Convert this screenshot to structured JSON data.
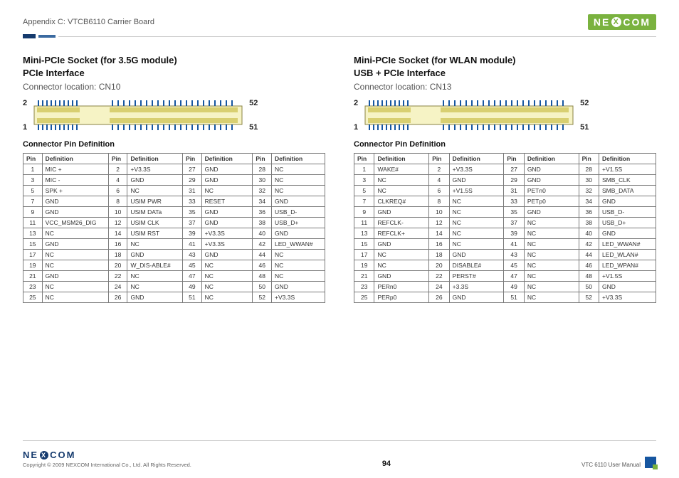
{
  "header": {
    "breadcrumb": "Appendix C: VTCB6110 Carrier Board",
    "brand_left": "NE",
    "brand_right": "COM",
    "brand_x": "X"
  },
  "left": {
    "title_line1": "Mini-PCIe Socket (for 3.5G module)",
    "title_line2": "PCIe Interface",
    "connector_location": "Connector location: CN10",
    "chip_labels": {
      "tl": "2",
      "bl": "1",
      "tr": "52",
      "br": "51"
    },
    "pin_def_label": "Connector Pin Definition",
    "table_headers": [
      "Pin",
      "Definition",
      "Pin",
      "Definition",
      "Pin",
      "Definition",
      "Pin",
      "Definition"
    ],
    "rows": [
      [
        "1",
        "MIC +",
        "2",
        "+V3.3S",
        "27",
        "GND",
        "28",
        "NC"
      ],
      [
        "3",
        "MIC -",
        "4",
        "GND",
        "29",
        "GND",
        "30",
        "NC"
      ],
      [
        "5",
        "SPK +",
        "6",
        "NC",
        "31",
        "NC",
        "32",
        "NC"
      ],
      [
        "7",
        "GND",
        "8",
        "USIM PWR",
        "33",
        "RESET",
        "34",
        "GND"
      ],
      [
        "9",
        "GND",
        "10",
        "USIM DATa",
        "35",
        "GND",
        "36",
        "USB_D-"
      ],
      [
        "11",
        "VCC_MSM26_DIG",
        "12",
        "USIM CLK",
        "37",
        "GND",
        "38",
        "USB_D+"
      ],
      [
        "13",
        "NC",
        "14",
        "USIM RST",
        "39",
        "+V3.3S",
        "40",
        "GND"
      ],
      [
        "15",
        "GND",
        "16",
        "NC",
        "41",
        "+V3.3S",
        "42",
        "LED_WWAN#"
      ],
      [
        "17",
        "NC",
        "18",
        "GND",
        "43",
        "GND",
        "44",
        "NC"
      ],
      [
        "19",
        "NC",
        "20",
        "W_DIS-ABLE#",
        "45",
        "NC",
        "46",
        "NC"
      ],
      [
        "21",
        "GND",
        "22",
        "NC",
        "47",
        "NC",
        "48",
        "NC"
      ],
      [
        "23",
        "NC",
        "24",
        "NC",
        "49",
        "NC",
        "50",
        "GND"
      ],
      [
        "25",
        "NC",
        "26",
        "GND",
        "51",
        "NC",
        "52",
        "+V3.3S"
      ]
    ]
  },
  "right": {
    "title_line1": "Mini-PCIe Socket (for WLAN module)",
    "title_line2": "USB + PCIe Interface",
    "connector_location": "Connector location: CN13",
    "chip_labels": {
      "tl": "2",
      "bl": "1",
      "tr": "52",
      "br": "51"
    },
    "pin_def_label": "Connector Pin Definition",
    "table_headers": [
      "Pin",
      "Definition",
      "Pin",
      "Definition",
      "Pin",
      "Definition",
      "Pin",
      "Definition"
    ],
    "rows": [
      [
        "1",
        "WAKE#",
        "2",
        "+V3.3S",
        "27",
        "GND",
        "28",
        "+V1.5S"
      ],
      [
        "3",
        "NC",
        "4",
        "GND",
        "29",
        "GND",
        "30",
        "SMB_CLK"
      ],
      [
        "5",
        "NC",
        "6",
        "+V1.5S",
        "31",
        "PETn0",
        "32",
        "SMB_DATA"
      ],
      [
        "7",
        "CLKREQ#",
        "8",
        "NC",
        "33",
        "PETp0",
        "34",
        "GND"
      ],
      [
        "9",
        "GND",
        "10",
        "NC",
        "35",
        "GND",
        "36",
        "USB_D-"
      ],
      [
        "11",
        "REFCLK-",
        "12",
        "NC",
        "37",
        "NC",
        "38",
        "USB_D+"
      ],
      [
        "13",
        "REFCLK+",
        "14",
        "NC",
        "39",
        "NC",
        "40",
        "GND"
      ],
      [
        "15",
        "GND",
        "16",
        "NC",
        "41",
        "NC",
        "42",
        "LED_WWAN#"
      ],
      [
        "17",
        "NC",
        "18",
        "GND",
        "43",
        "NC",
        "44",
        "LED_WLAN#"
      ],
      [
        "19",
        "NC",
        "20",
        "DISABLE#",
        "45",
        "NC",
        "46",
        "LED_WPAN#"
      ],
      [
        "21",
        "GND",
        "22",
        "PERST#",
        "47",
        "NC",
        "48",
        "+V1.5S"
      ],
      [
        "23",
        "PERn0",
        "24",
        "+3.3S",
        "49",
        "NC",
        "50",
        "GND"
      ],
      [
        "25",
        "PERp0",
        "26",
        "GND",
        "51",
        "NC",
        "52",
        "+V3.3S"
      ]
    ]
  },
  "footer": {
    "brand_left": "NE",
    "brand_right": "COM",
    "brand_x": "X",
    "copyright": "Copyright © 2009 NEXCOM International Co., Ltd. All Rights Reserved.",
    "page_number": "94",
    "doc_title": "VTC 6110 User Manual"
  }
}
